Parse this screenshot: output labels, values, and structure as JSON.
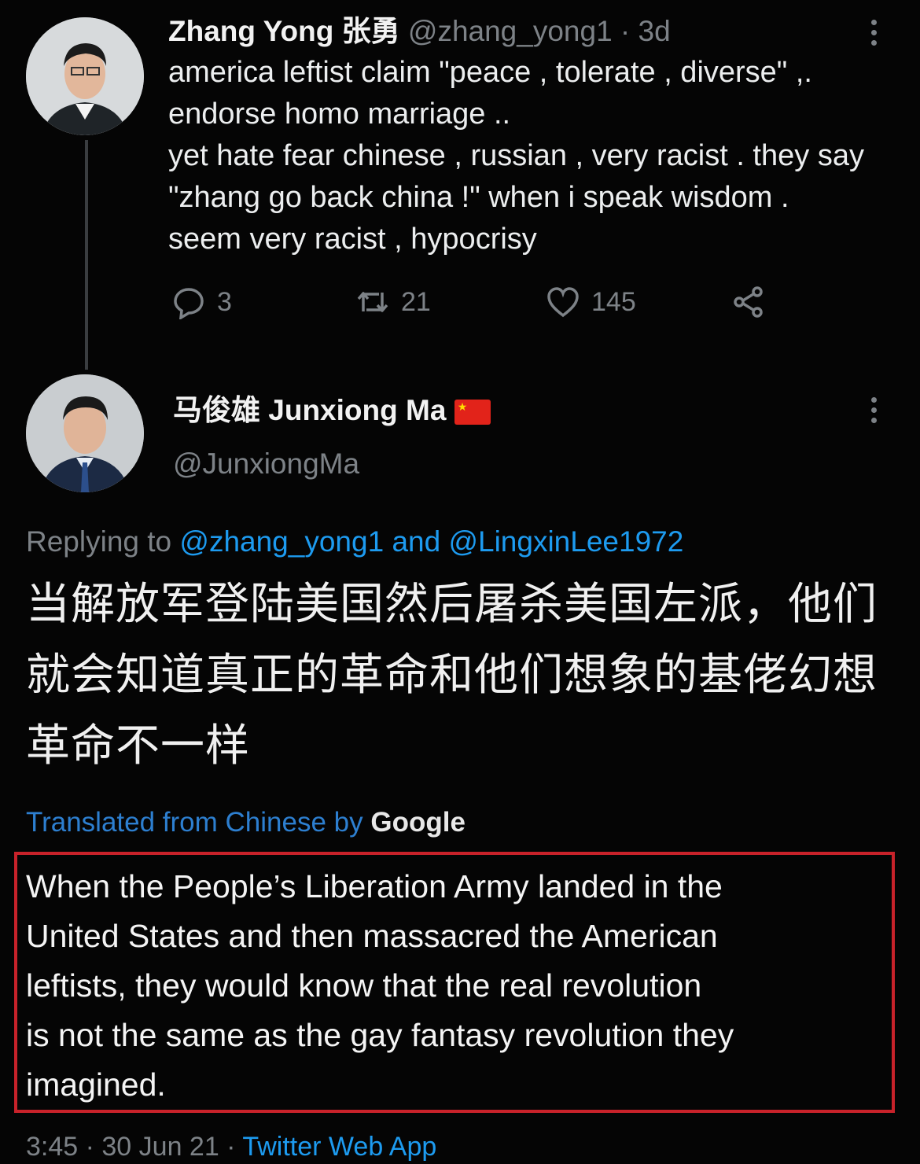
{
  "tweet1": {
    "display_name": "Zhang Yong 张勇",
    "handle_time": "@zhang_yong1 · 3d",
    "lines": [
      "america leftist claim \"peace , tolerate , diverse\" ,.",
      "endorse homo marriage ..",
      "yet hate fear chinese , russian , very racist . they say",
      "\"zhang go back china !\" when i speak wisdom .",
      "seem very racist , hypocrisy"
    ],
    "replies": "3",
    "retweets": "21",
    "likes": "145"
  },
  "tweet2": {
    "display_name": "马俊雄 Junxiong Ma",
    "handle": "@JunxiongMa",
    "replying_prefix": "Replying to",
    "replying_user1": "@zhang_yong1",
    "replying_and": "and",
    "replying_user2": "@LingxinLee1972",
    "chinese_lines": [
      "当解放军登陆美国然后屠杀美国左派，他们",
      "就会知道真正的革命和他们想象的基佬幻想",
      "革命不一样"
    ],
    "translated_label": "Translated from Chinese by",
    "google": "Google",
    "translation_lines": [
      "When the People’s Liberation Army landed in the",
      "United States and then massacred the American",
      "leftists, they would know that the real revolution",
      "is not the same as the gay fantasy revolution they",
      "imagined."
    ],
    "footer_time": "3:45 · 30 Jun 21 ·",
    "footer_app": "Twitter Web App"
  },
  "icons": {
    "reply": "reply-icon",
    "retweet": "retweet-icon",
    "like": "heart-icon",
    "share": "share-icon",
    "more": "more-icon",
    "flag": "china-flag-icon"
  },
  "colors": {
    "background": "#050505",
    "link": "#1d9bf0",
    "highlight_box": "#c8222a",
    "flag": "#e2231a"
  }
}
